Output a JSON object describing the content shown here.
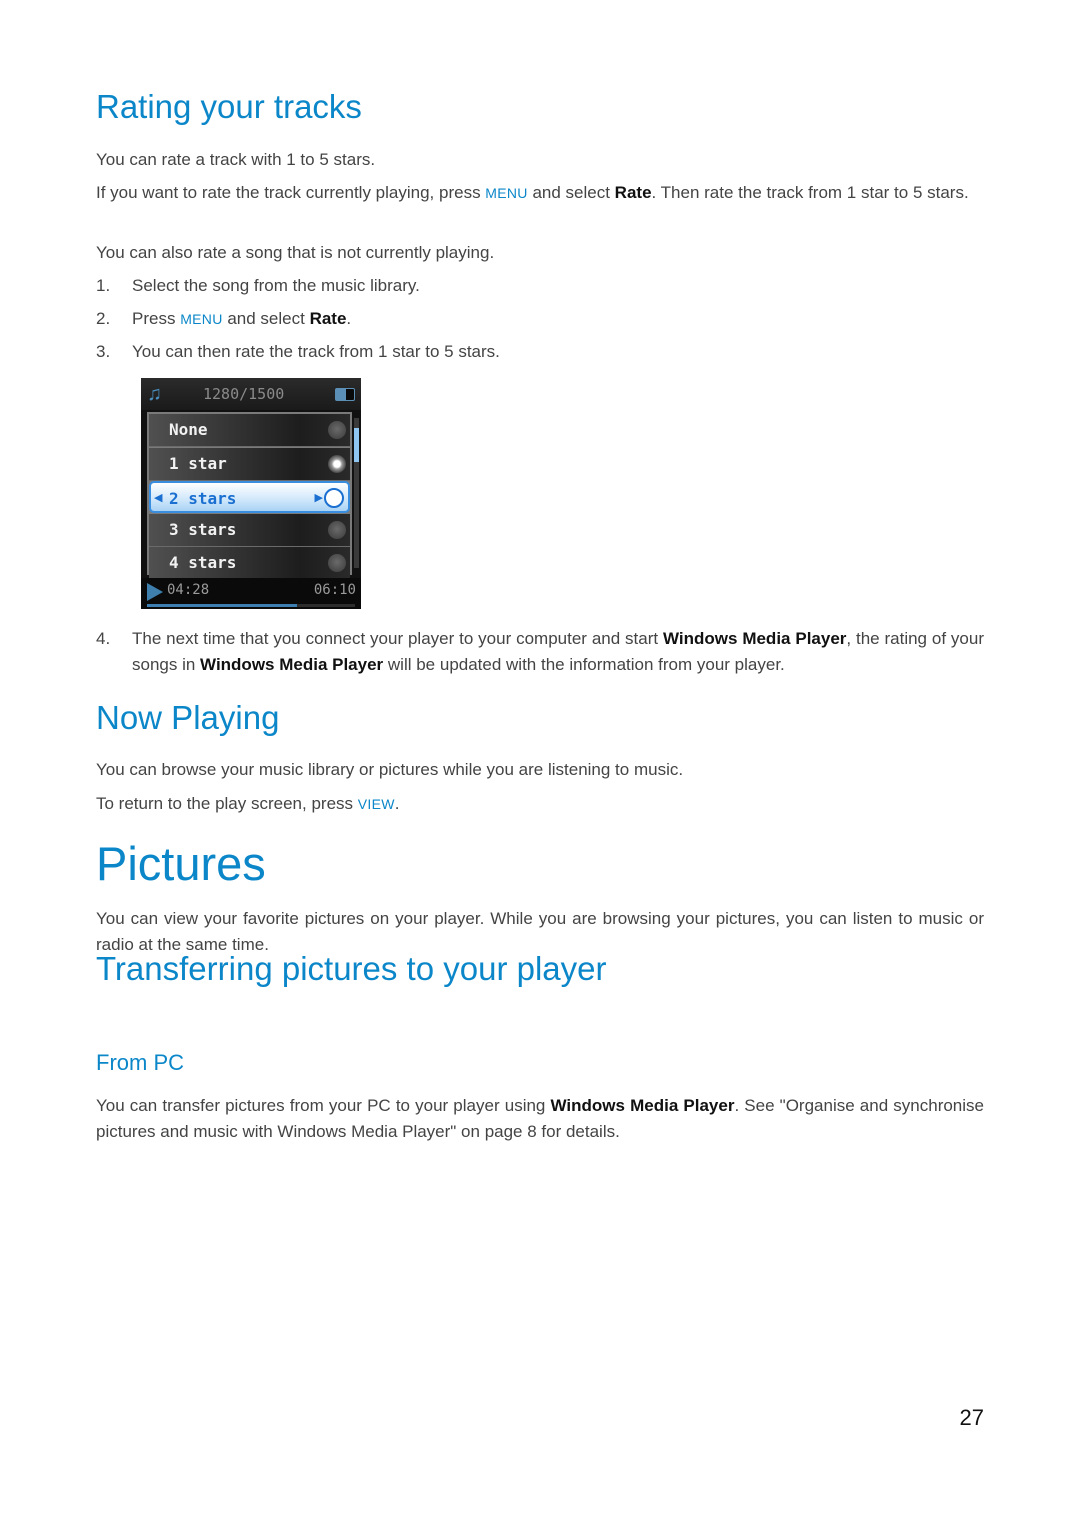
{
  "rating": {
    "heading": "Rating your tracks",
    "p1": "You can rate a track with 1 to 5 stars.",
    "p2_a": "If you want to rate the track currently playing, press ",
    "p2_key": "MENU",
    "p2_b": " and select ",
    "p2_bold": "Rate",
    "p2_c": ". Then rate the track from 1 star to 5 stars.",
    "p3": "You can also rate a song that is not currently playing.",
    "steps": [
      {
        "num": "1.",
        "text": "Select the song from the music library."
      },
      {
        "num": "2.",
        "text_a": "Press ",
        "key": "MENU",
        "text_b": " and select ",
        "bold": "Rate",
        "text_c": "."
      },
      {
        "num": "3.",
        "text": "You can then rate the track from 1 star to 5 stars."
      },
      {
        "num": "4.",
        "text_a": "The next time that you connect your player to your computer and start ",
        "bold1": "Windows Media Player",
        "text_b": ", the rating of your songs in ",
        "bold2": "Windows Media Player",
        "text_c": " will be updated with the information from your player."
      }
    ]
  },
  "device_screen": {
    "track_counter": "1280/1500",
    "icons": {
      "music": "music-note-icon",
      "battery": "battery-icon",
      "play": "play-icon"
    },
    "options": [
      {
        "label": "None",
        "selected": false,
        "current": false
      },
      {
        "label": "1 star",
        "selected": false,
        "current": true
      },
      {
        "label": "2 stars",
        "selected": true,
        "current": false
      },
      {
        "label": "3 stars",
        "selected": false,
        "current": false
      },
      {
        "label": "4 stars",
        "selected": false,
        "current": false
      }
    ],
    "elapsed": "04:28",
    "total": "06:10",
    "progress_fraction": 0.72,
    "battery_level_fraction": 0.55
  },
  "now_playing": {
    "heading": "Now Playing",
    "p1": "You can browse your music library or pictures while you are listening to music.",
    "p2_a": "To return to the play screen, press ",
    "p2_key": "VIEW",
    "p2_b": "."
  },
  "pictures": {
    "heading": "Pictures",
    "p1": "You can view your favorite pictures on your player. While you are browsing your pictures, you can listen to music or radio at the same time."
  },
  "transfer": {
    "heading": "Transferring pictures to your player",
    "subheading": "From PC",
    "p_a": "You can transfer pictures from your PC to your player using ",
    "p_bold": "Windows Media Player",
    "p_b": ". See \"Organise and synchronise pictures and music with Windows Media Player\" on page 8 for details."
  },
  "page_number": "27"
}
